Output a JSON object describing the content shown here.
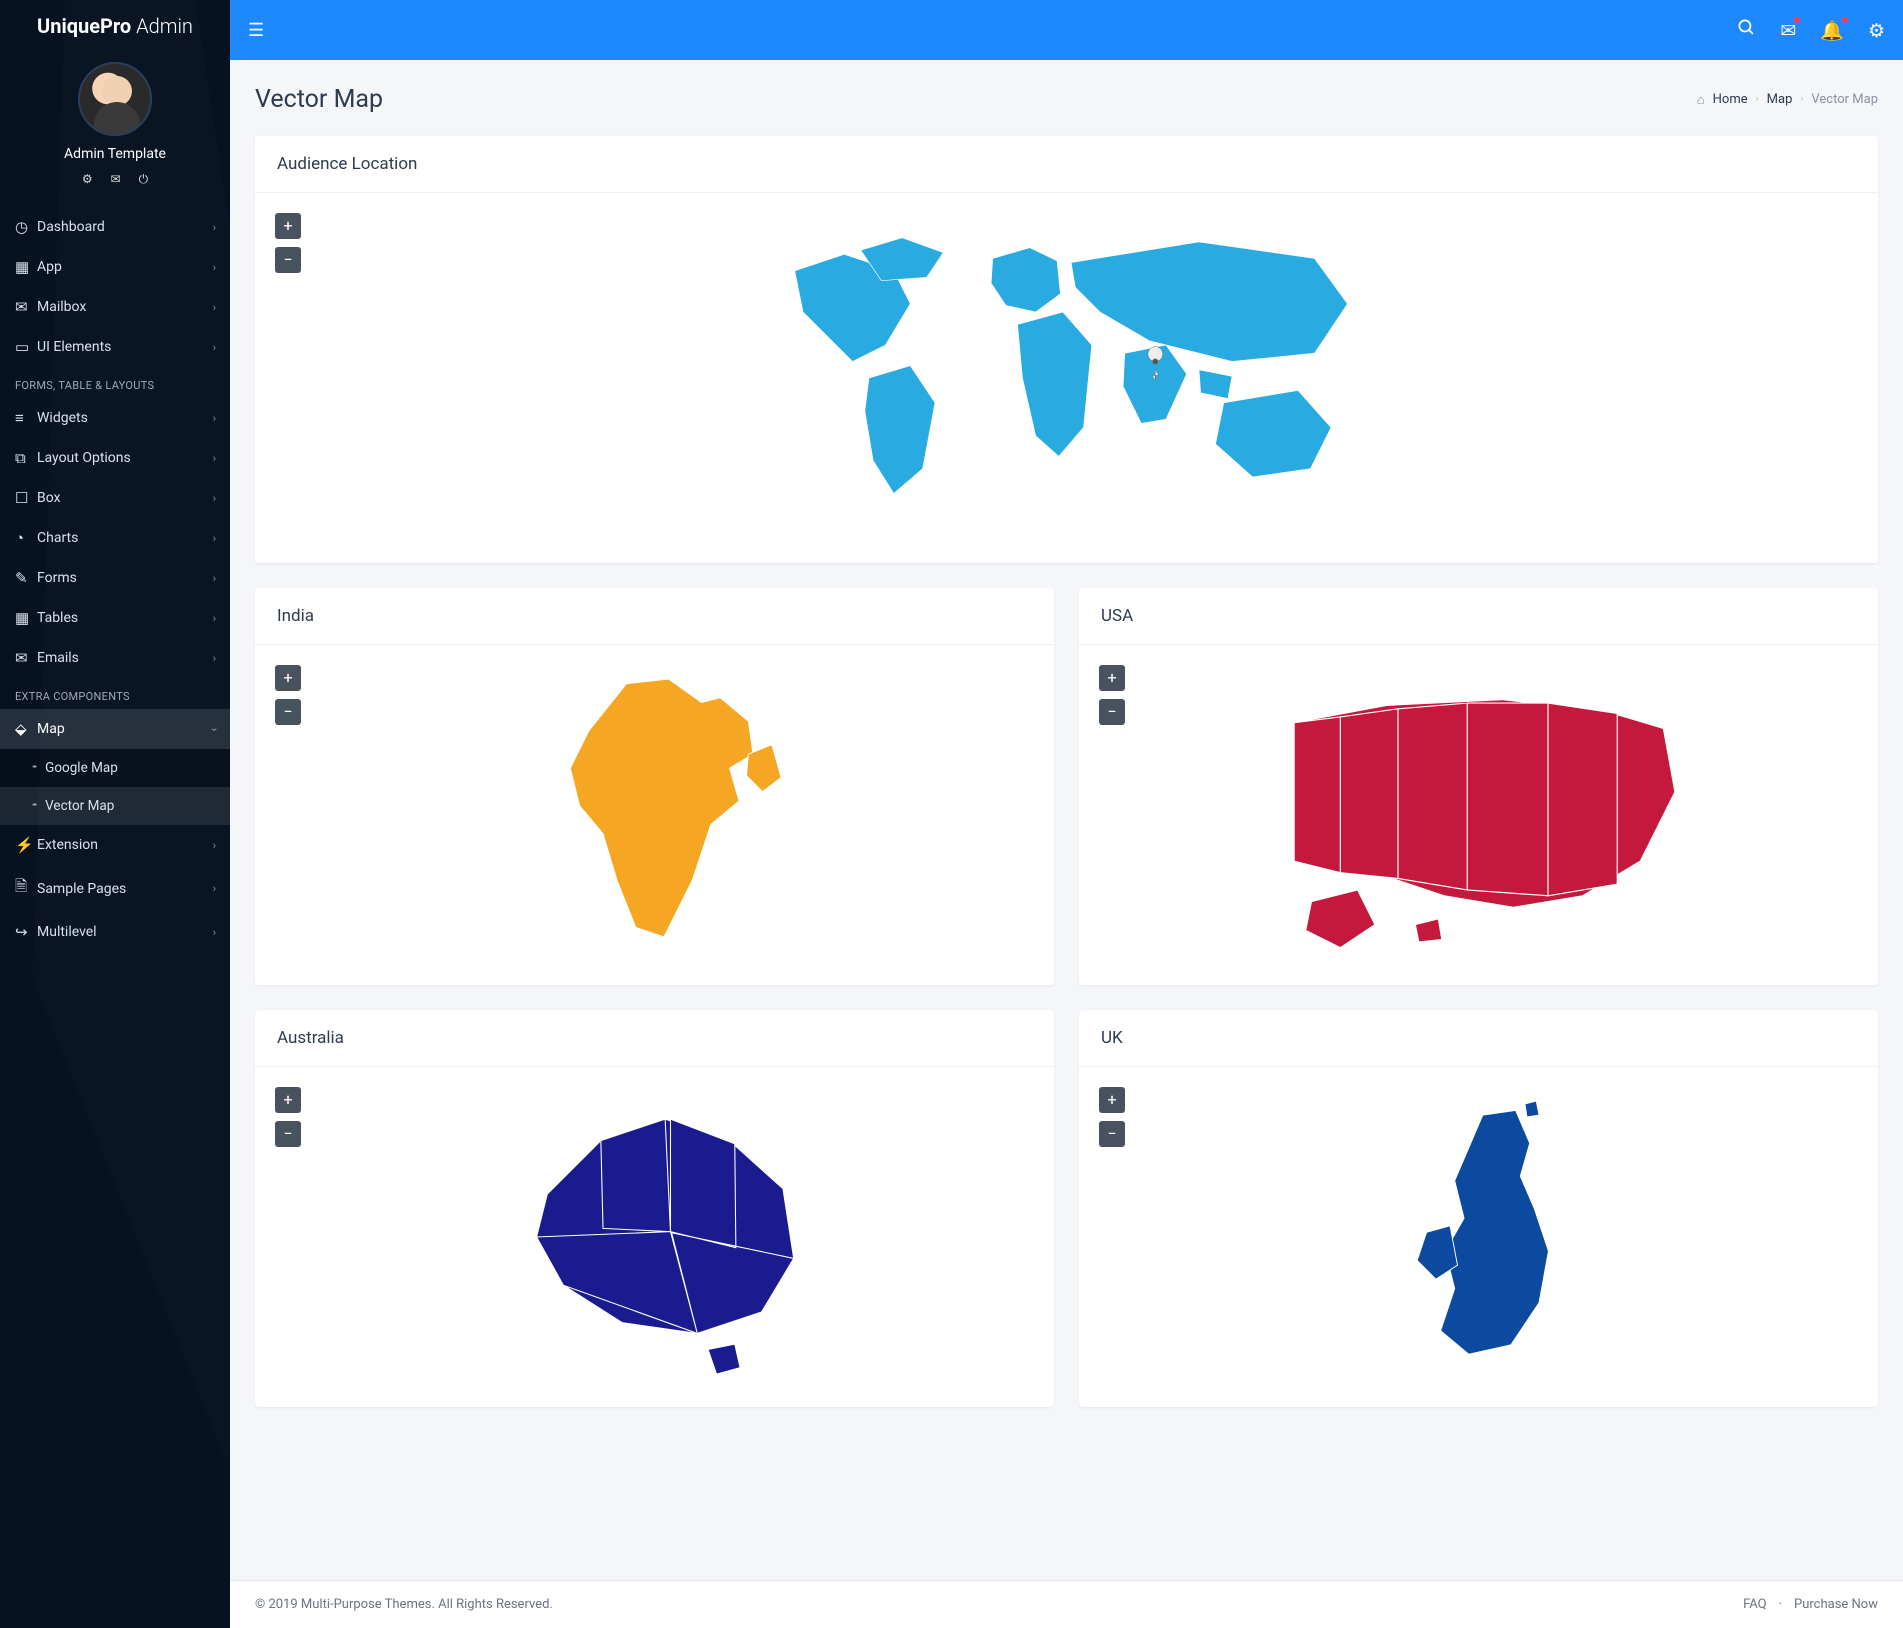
{
  "brand": {
    "bold": "UniquePro",
    "light": "Admin"
  },
  "user": {
    "name": "Admin Template"
  },
  "nav": {
    "items1": [
      {
        "icon": "◷",
        "label": "Dashboard"
      },
      {
        "icon": "▦",
        "label": "App"
      },
      {
        "icon": "✉",
        "label": "Mailbox"
      },
      {
        "icon": "▭",
        "label": "UI Elements"
      }
    ],
    "header1": "FORMS, TABLE & LAYOUTS",
    "items2": [
      {
        "icon": "≡",
        "label": "Widgets"
      },
      {
        "icon": "⧉",
        "label": "Layout Options"
      },
      {
        "icon": "☐",
        "label": "Box"
      },
      {
        "icon": "◔",
        "label": "Charts"
      },
      {
        "icon": "✎",
        "label": "Forms"
      },
      {
        "icon": "▦",
        "label": "Tables"
      },
      {
        "icon": "✉",
        "label": "Emails"
      }
    ],
    "header2": "EXTRA COMPONENTS",
    "map": {
      "icon": "⬙",
      "label": "Map",
      "sub": [
        "Google Map",
        "Vector Map"
      ]
    },
    "items3": [
      {
        "icon": "⚡",
        "label": "Extension"
      },
      {
        "icon": "🗎",
        "label": "Sample Pages"
      },
      {
        "icon": "↪",
        "label": "Multilevel"
      }
    ]
  },
  "page": {
    "title": "Vector Map"
  },
  "crumb": {
    "home": "Home",
    "map": "Map",
    "cur": "Vector Map"
  },
  "cards": {
    "world": "Audience Location",
    "india": "India",
    "usa": "USA",
    "aus": "Australia",
    "uk": "UK"
  },
  "zoom": {
    "in": "+",
    "out": "−"
  },
  "footer": {
    "copy": "© 2019 Multi-Purpose Themes. All Rights Reserved.",
    "faq": "FAQ",
    "sep": "·",
    "buy": "Purchase Now"
  }
}
